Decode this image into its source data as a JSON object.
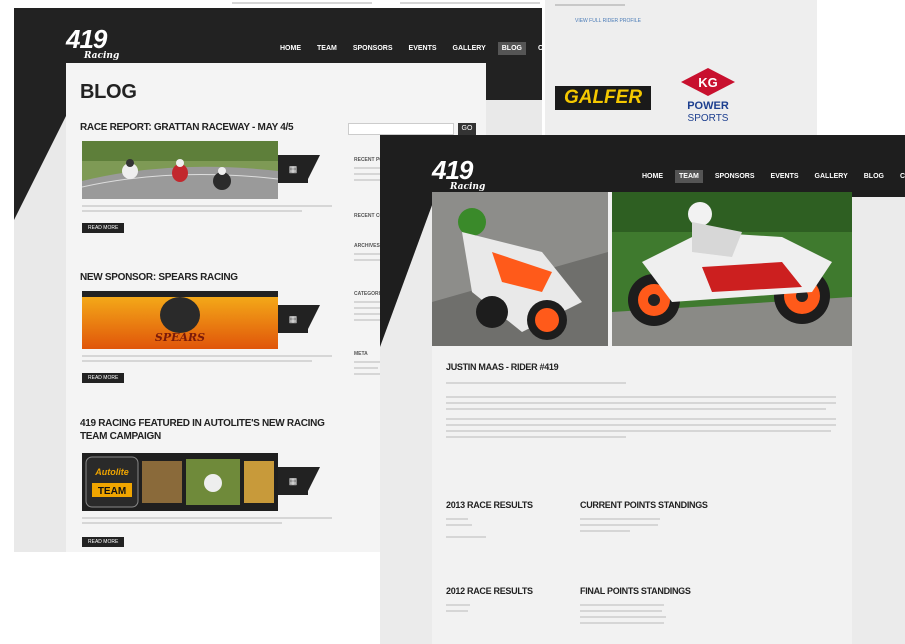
{
  "back_page": {
    "logo": {
      "number": "419",
      "script": "Racing"
    },
    "nav": [
      "HOME",
      "TEAM",
      "SPONSORS",
      "EVENTS",
      "GALLERY",
      "BLOG",
      "CONTACT"
    ],
    "active_nav": "BLOG",
    "blog_title": "BLOG",
    "search_button": "GO",
    "posts": [
      {
        "title": "RACE REPORT: GRATTAN RACEWAY - MAY 4/5",
        "read_more": "READ MORE"
      },
      {
        "title": "NEW SPONSOR: SPEARS RACING",
        "read_more": "READ MORE"
      },
      {
        "title": "419 RACING FEATURED IN AUTOLITE'S NEW RACING TEAM CAMPAIGN",
        "read_more": "READ MORE"
      }
    ],
    "sidebar_headings": [
      "RECENT POSTS",
      "RECENT COMMENTS",
      "ARCHIVES",
      "CATEGORIES",
      "META"
    ],
    "sponsor_banners": [
      "SPEARS",
      "Autolite TEAM"
    ]
  },
  "sponsor_panel": {
    "link": "VIEW FULL RIDER PROFILE",
    "sponsors": [
      "GALFER",
      "KG",
      "POWER SPORTS"
    ]
  },
  "front_page": {
    "logo": {
      "number": "419",
      "script": "Racing"
    },
    "nav": [
      "HOME",
      "TEAM",
      "SPONSORS",
      "EVENTS",
      "GALLERY",
      "BLOG",
      "CONTACT"
    ],
    "active_nav": "TEAM",
    "rider_heading": "JUSTIN MAAS - RIDER #419",
    "sections": [
      {
        "title": "2013 RACE RESULTS"
      },
      {
        "title": "CURRENT POINTS STANDINGS"
      },
      {
        "title": "2012 RACE RESULTS"
      },
      {
        "title": "FINAL POINTS STANDINGS"
      }
    ]
  },
  "colors": {
    "header": "#222222",
    "accent_yellow": "#f5c800",
    "kg_red": "#c8102e",
    "kg_blue": "#1d3f8f",
    "bike_orange": "#ff5a1a"
  }
}
